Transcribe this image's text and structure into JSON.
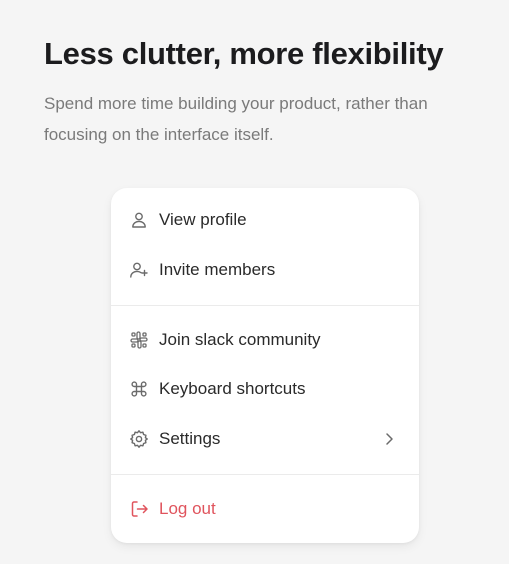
{
  "hero": {
    "title": "Less clutter, more flexibility",
    "subtitle": "Spend more time building your product, rather than focusing on the interface itself."
  },
  "menu": {
    "items": [
      {
        "label": "View profile",
        "icon": "user-icon"
      },
      {
        "label": "Invite members",
        "icon": "user-plus-icon"
      },
      {
        "label": "Join slack community",
        "icon": "slack-icon"
      },
      {
        "label": "Keyboard shortcuts",
        "icon": "command-icon"
      },
      {
        "label": "Settings",
        "icon": "gear-icon"
      },
      {
        "label": "Log out",
        "icon": "logout-icon"
      }
    ]
  },
  "colors": {
    "background": "#f5f5f5",
    "text": "#2a2a2a",
    "muted": "#7a7a7a",
    "danger": "#e0545d"
  }
}
